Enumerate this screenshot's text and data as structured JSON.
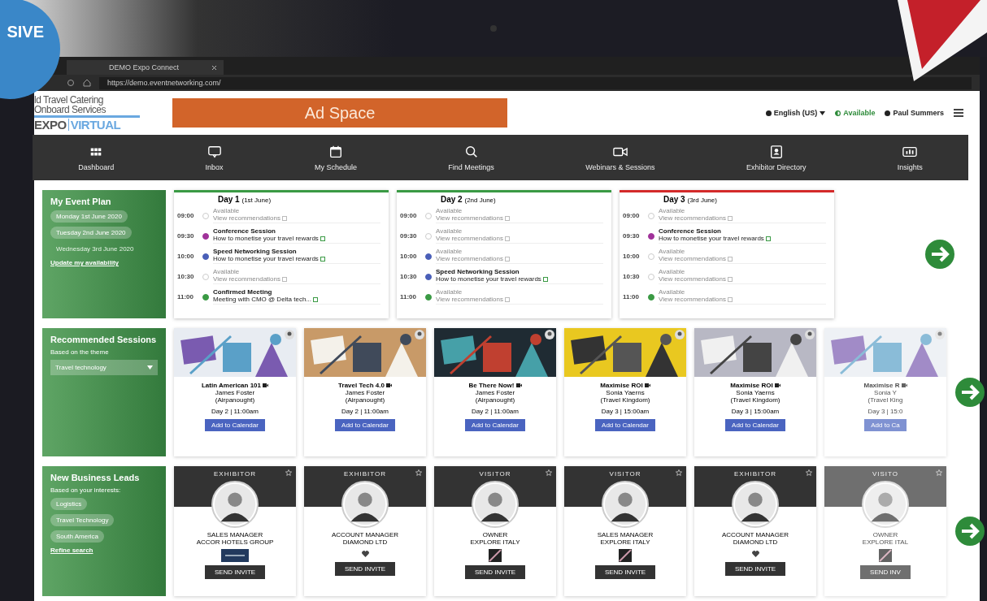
{
  "badge": {
    "text": "SIVE"
  },
  "browser": {
    "tab_title": "DEMO Expo Connect",
    "url": "https://demo.eventnetworking.com/"
  },
  "header": {
    "logo_lines": [
      "ld Travel Catering",
      "Onboard Services"
    ],
    "logo_expo": "EXPO",
    "logo_virtual": "VIRTUAL",
    "ad": "Ad Space",
    "language": "English (US)",
    "status": "Available",
    "user": "Paul Summers"
  },
  "nav": [
    {
      "label": "Dashboard",
      "kind": "grid"
    },
    {
      "label": "Inbox",
      "kind": "chat"
    },
    {
      "label": "My Schedule",
      "kind": "calendar"
    },
    {
      "label": "Find Meetings",
      "kind": "search"
    },
    {
      "label": "Webinars & Sessions",
      "kind": "video"
    },
    {
      "label": "Exhibitor Directory",
      "kind": "contact"
    },
    {
      "label": "Insights",
      "kind": "chart"
    }
  ],
  "event_plan": {
    "title": "My Event Plan",
    "dates": [
      {
        "label": "Monday 1st June 2020",
        "disabled": false
      },
      {
        "label": "Tuesday 2nd June 2020",
        "disabled": false
      },
      {
        "label": "Wednesday 3rd June 2020",
        "disabled": true
      }
    ],
    "link": "Update my availability"
  },
  "days": [
    {
      "title": "Day 1",
      "date": "(1st June)",
      "color": "#3a9a44",
      "slots": [
        {
          "time": "09:00",
          "kind": "available",
          "title": "Available",
          "subtitle": "View recommendations"
        },
        {
          "time": "09:30",
          "kind": "booked",
          "color": "#a0329a",
          "title": "Conference Session",
          "subtitle": "How to monetise your travel rewards"
        },
        {
          "time": "10:00",
          "kind": "booked",
          "color": "#4a5fb8",
          "title": "Speed Networking Session",
          "subtitle": "How to monetise your travel rewards"
        },
        {
          "time": "10:30",
          "kind": "available",
          "title": "Available",
          "subtitle": "View recommendations"
        },
        {
          "time": "11:00",
          "kind": "booked",
          "color": "#3a9a44",
          "title": "Confirmed Meeting",
          "subtitle": "Meeting with CMO @ Delta tech..."
        }
      ]
    },
    {
      "title": "Day 2",
      "date": "(2nd June)",
      "color": "#3a9a44",
      "slots": [
        {
          "time": "09:00",
          "kind": "available",
          "title": "Available",
          "subtitle": "View recommendations"
        },
        {
          "time": "09:30",
          "kind": "available",
          "title": "Available",
          "subtitle": "View recommendations"
        },
        {
          "time": "10:00",
          "kind": "available",
          "color": "#4a5fb8",
          "title": "Available",
          "subtitle": "View recommendations"
        },
        {
          "time": "10:30",
          "kind": "booked",
          "color": "#4a5fb8",
          "title": "Speed Networking Session",
          "subtitle": "How to monetise your travel rewards"
        },
        {
          "time": "11:00",
          "kind": "available",
          "color": "#3a9a44",
          "title": "Available",
          "subtitle": "View recommendations"
        }
      ]
    },
    {
      "title": "Day 3",
      "date": "(3rd June)",
      "color": "#d42a2a",
      "slots": [
        {
          "time": "09:00",
          "kind": "available",
          "title": "Available",
          "subtitle": "View recommendations"
        },
        {
          "time": "09:30",
          "kind": "booked",
          "color": "#a0329a",
          "title": "Conference Session",
          "subtitle": "How to monetise your travel rewards"
        },
        {
          "time": "10:00",
          "kind": "available",
          "title": "Available",
          "subtitle": "View recommendations"
        },
        {
          "time": "10:30",
          "kind": "available",
          "title": "Available",
          "subtitle": "View recommendations"
        },
        {
          "time": "11:00",
          "kind": "available",
          "color": "#3a9a44",
          "title": "Available",
          "subtitle": "View recommendations"
        }
      ]
    }
  ],
  "sessions": {
    "title": "Recommended Sessions",
    "subtitle": "Based on the theme",
    "theme": "Travel technology",
    "items": [
      {
        "title": "Latin American 101",
        "speaker": "James Foster",
        "company": "(Airpanought)",
        "time": "Day 2 | 11:00am",
        "button": "Add to Calendar",
        "kind": "picture",
        "faded": false
      },
      {
        "title": "Travel Tech 4.0",
        "speaker": "James Foster",
        "company": "(Airpanought)",
        "time": "Day 2 | 11:00am",
        "button": "Add to Calendar",
        "kind": "picture",
        "faded": false
      },
      {
        "title": "Be There Now!",
        "speaker": "James Foster",
        "company": "(Airpanought)",
        "time": "Day 2 | 11:00am",
        "button": "Add to Calendar",
        "kind": "picture",
        "faded": false
      },
      {
        "title": "Maximise ROI",
        "speaker": "Sonia Yaerns",
        "company": "(Travel Kingdom)",
        "time": "Day 3 | 15:00am",
        "button": "Add to Calendar",
        "kind": "picture",
        "faded": false
      },
      {
        "title": "Maximise ROI",
        "speaker": "Sonia Yaerns",
        "company": "(Travel Kingdom)",
        "time": "Day 3 | 15:00am",
        "button": "Add to Calendar",
        "kind": "picture",
        "faded": false
      },
      {
        "title": "Maximise R",
        "speaker": "Sonia Y",
        "company": "(Travel King",
        "time": "Day 3 | 15:0",
        "button": "Add to Ca",
        "kind": "picture",
        "faded": true
      }
    ]
  },
  "leads": {
    "title": "New Business Leads",
    "subtitle": "Based on your interests:",
    "tags": [
      "Logistics",
      "Travel Technology",
      "South America"
    ],
    "link": "Refine search",
    "items": [
      {
        "role": "EXHIBITOR",
        "position": "SALES MANAGER",
        "company": "ACCOR HOTELS GROUP",
        "button": "SEND INVITE",
        "kind": "wordmark",
        "faded": false
      },
      {
        "role": "EXHIBITOR",
        "position": "ACCOUNT MANAGER",
        "company": "DIAMOND LTD",
        "button": "SEND INVITE",
        "kind": "heart",
        "faded": false
      },
      {
        "role": "VISITOR",
        "position": "OWNER",
        "company": "EXPLORE ITALY",
        "button": "SEND INVITE",
        "kind": "stripe",
        "faded": false
      },
      {
        "role": "VISITOR",
        "position": "SALES MANAGER",
        "company": "EXPLORE ITALY",
        "button": "SEND INVITE",
        "kind": "stripe",
        "faded": false
      },
      {
        "role": "EXHIBITOR",
        "position": "ACCOUNT MANAGER",
        "company": "DIAMOND LTD",
        "button": "SEND INVITE",
        "kind": "heart",
        "faded": false
      },
      {
        "role": "VISITO",
        "position": "OWNER",
        "company": "EXPLORE ITAL",
        "button": "SEND INV",
        "kind": "stripe",
        "faded": true
      }
    ]
  }
}
